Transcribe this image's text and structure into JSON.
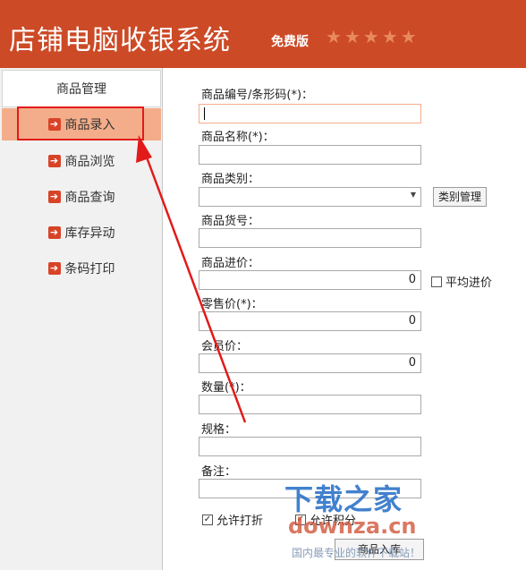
{
  "header": {
    "title": "店铺电脑收银系统",
    "edition": "免费版",
    "star_count": 5
  },
  "sidebar": {
    "section_title": "商品管理",
    "items": [
      {
        "label": "商品录入",
        "active": true
      },
      {
        "label": "商品浏览",
        "active": false
      },
      {
        "label": "商品查询",
        "active": false
      },
      {
        "label": "库存异动",
        "active": false
      },
      {
        "label": "条码打印",
        "active": false
      }
    ]
  },
  "form": {
    "barcode": {
      "label": "商品编号/条形码(*)：",
      "value": ""
    },
    "name": {
      "label": "商品名称(*)：",
      "value": ""
    },
    "category": {
      "label": "商品类别：",
      "value": "",
      "manage_button": "类别管理"
    },
    "sku": {
      "label": "商品货号：",
      "value": ""
    },
    "cost_price": {
      "label": "商品进价：",
      "value": "0",
      "avg_checkbox": "平均进价",
      "avg_checked": false
    },
    "retail_price": {
      "label": "零售价(*)：",
      "value": "0"
    },
    "member_price": {
      "label": "会员价：",
      "value": "0"
    },
    "quantity": {
      "label": "数量(*)：",
      "value": ""
    },
    "spec": {
      "label": "规格：",
      "value": ""
    },
    "notes": {
      "label": "备注：",
      "value": ""
    },
    "allow_discount": {
      "label": "允许打折",
      "checked": true
    },
    "allow_points": {
      "label": "允许积分",
      "checked": true
    },
    "submit_label": "商品入库"
  },
  "watermark": {
    "title": "下载之家",
    "domain": "downza.cn",
    "slogan": "国内最专业的软件下载站！"
  },
  "colors": {
    "header_bg": "#cc4a26",
    "active_nav": "#f4ad8a",
    "annotation": "#e21a1a"
  }
}
